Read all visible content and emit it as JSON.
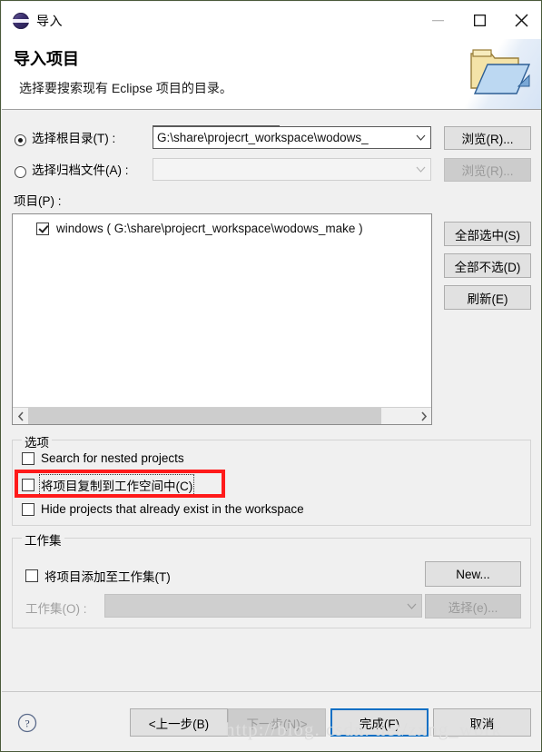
{
  "window": {
    "title": "导入",
    "icon": "eclipse-icon",
    "controls": {
      "minimize": "minimize-icon",
      "maximize": "maximize-icon",
      "close": "close-icon"
    }
  },
  "header": {
    "title": "导入项目",
    "subtitle": "选择要搜索现有 Eclipse 项目的目录。",
    "art_icon": "open-folder-icon"
  },
  "source": {
    "root_radio": {
      "label": "选择根目录(T) :",
      "checked": true
    },
    "archive_radio": {
      "label": "选择归档文件(A) :",
      "checked": false
    },
    "root_combo": {
      "value": "G:\\share\\projecrt_workspace\\wodows_",
      "enabled": true
    },
    "archive_combo": {
      "value": "",
      "enabled": false
    },
    "browse_root_button": "浏览(R)...",
    "browse_archive_button": "浏览(R)..."
  },
  "projects": {
    "label": "项目(P) :",
    "items": [
      {
        "name": "windows ( G:\\share\\projecrt_workspace\\wodows_make )",
        "checked": true
      }
    ],
    "select_all_button": "全部选中(S)",
    "deselect_all_button": "全部不选(D)",
    "refresh_button": "刷新(E)"
  },
  "options": {
    "group_title": "选项",
    "checkboxes": [
      {
        "label": "Search for nested projects",
        "checked": false,
        "highlighted": false,
        "focused": false
      },
      {
        "label": "将项目复制到工作空间中(C)",
        "checked": false,
        "highlighted": true,
        "focused": true
      },
      {
        "label": "Hide projects that already exist in the workspace",
        "checked": false,
        "highlighted": false,
        "focused": false
      }
    ]
  },
  "working_set": {
    "group_title": "工作集",
    "add_checkbox": {
      "label": "将项目添加至工作集(T)",
      "checked": false
    },
    "combo_label": "工作集(O) :",
    "combo_value": "",
    "new_button": "New...",
    "select_button": "选择(e)..."
  },
  "footer": {
    "help_icon": "help-icon",
    "back_button": "<上一步(B)",
    "next_button": "下一步(N)>",
    "finish_button": "完成(F)",
    "cancel_button": "取消"
  },
  "watermark": "http://blog. csdn. net/zxng_work",
  "colors": {
    "accent": "#0c6fc4",
    "highlight": "#ff1a1a",
    "dialog_bg": "#f0f0f0",
    "header_bg": "#ffffff"
  }
}
